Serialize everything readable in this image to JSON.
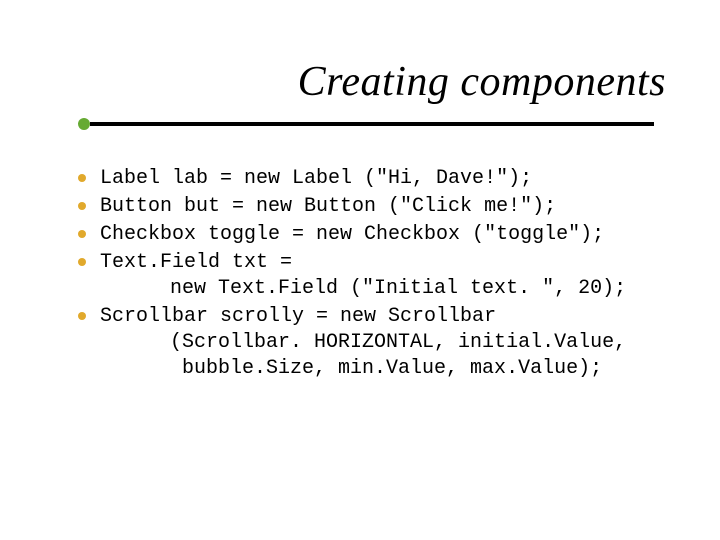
{
  "title": "Creating components",
  "colors": {
    "bullet": "#e1a92c",
    "rule_dot": "#66aa33",
    "rule_line": "#000000"
  },
  "items": [
    {
      "lines": [
        "Label lab = new Label (\"Hi, Dave!\");"
      ]
    },
    {
      "lines": [
        "Button but = new Button (\"Click me!\");"
      ]
    },
    {
      "lines": [
        "Checkbox toggle = new Checkbox (\"toggle\");"
      ]
    },
    {
      "lines": [
        "Text.Field txt =",
        "    new Text.Field (\"Initial text. \", 20);"
      ]
    },
    {
      "lines": [
        "Scrollbar scrolly = new Scrollbar",
        "    (Scrollbar. HORIZONTAL, initial.Value,",
        "     bubble.Size, min.Value, max.Value);"
      ]
    }
  ]
}
